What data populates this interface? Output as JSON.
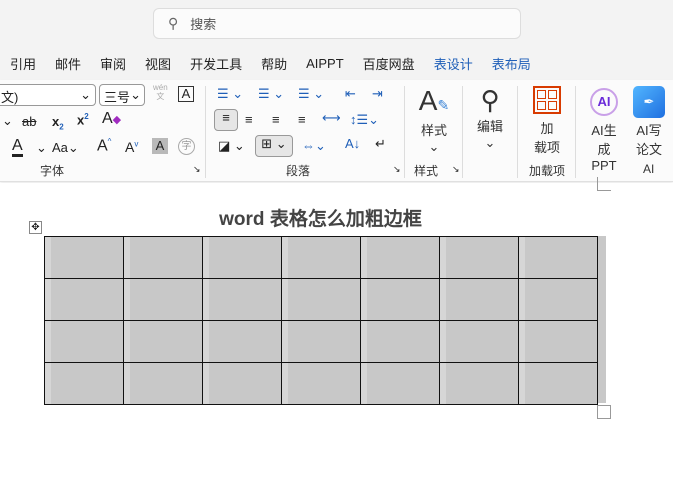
{
  "search": {
    "placeholder": "搜索"
  },
  "menu": [
    "引用",
    "邮件",
    "审阅",
    "视图",
    "开发工具",
    "帮助",
    "AIPPT",
    "百度网盘",
    "表设计",
    "表布局"
  ],
  "font": {
    "name": "文)",
    "size": "三号",
    "group": "字体",
    "phonetic_top": "wén",
    "phonetic_bottom": "文"
  },
  "paragraph": {
    "group": "段落"
  },
  "styles": {
    "label": "样式",
    "group": "样式"
  },
  "edit": {
    "label": "编辑"
  },
  "addins": {
    "label1": "加",
    "label2": "载项",
    "group": "加载项"
  },
  "ai": {
    "ppt1": "AI生",
    "ppt2": "成PPT",
    "write1": "AI写",
    "write2": "论文",
    "group": "AI"
  },
  "document": {
    "title": "word 表格怎么加粗边框",
    "rows": 4,
    "cols": 7
  },
  "colors": {
    "table_fill": "#c8c8c8",
    "accent": "#1f5fb8",
    "addin": "#d83b01"
  }
}
